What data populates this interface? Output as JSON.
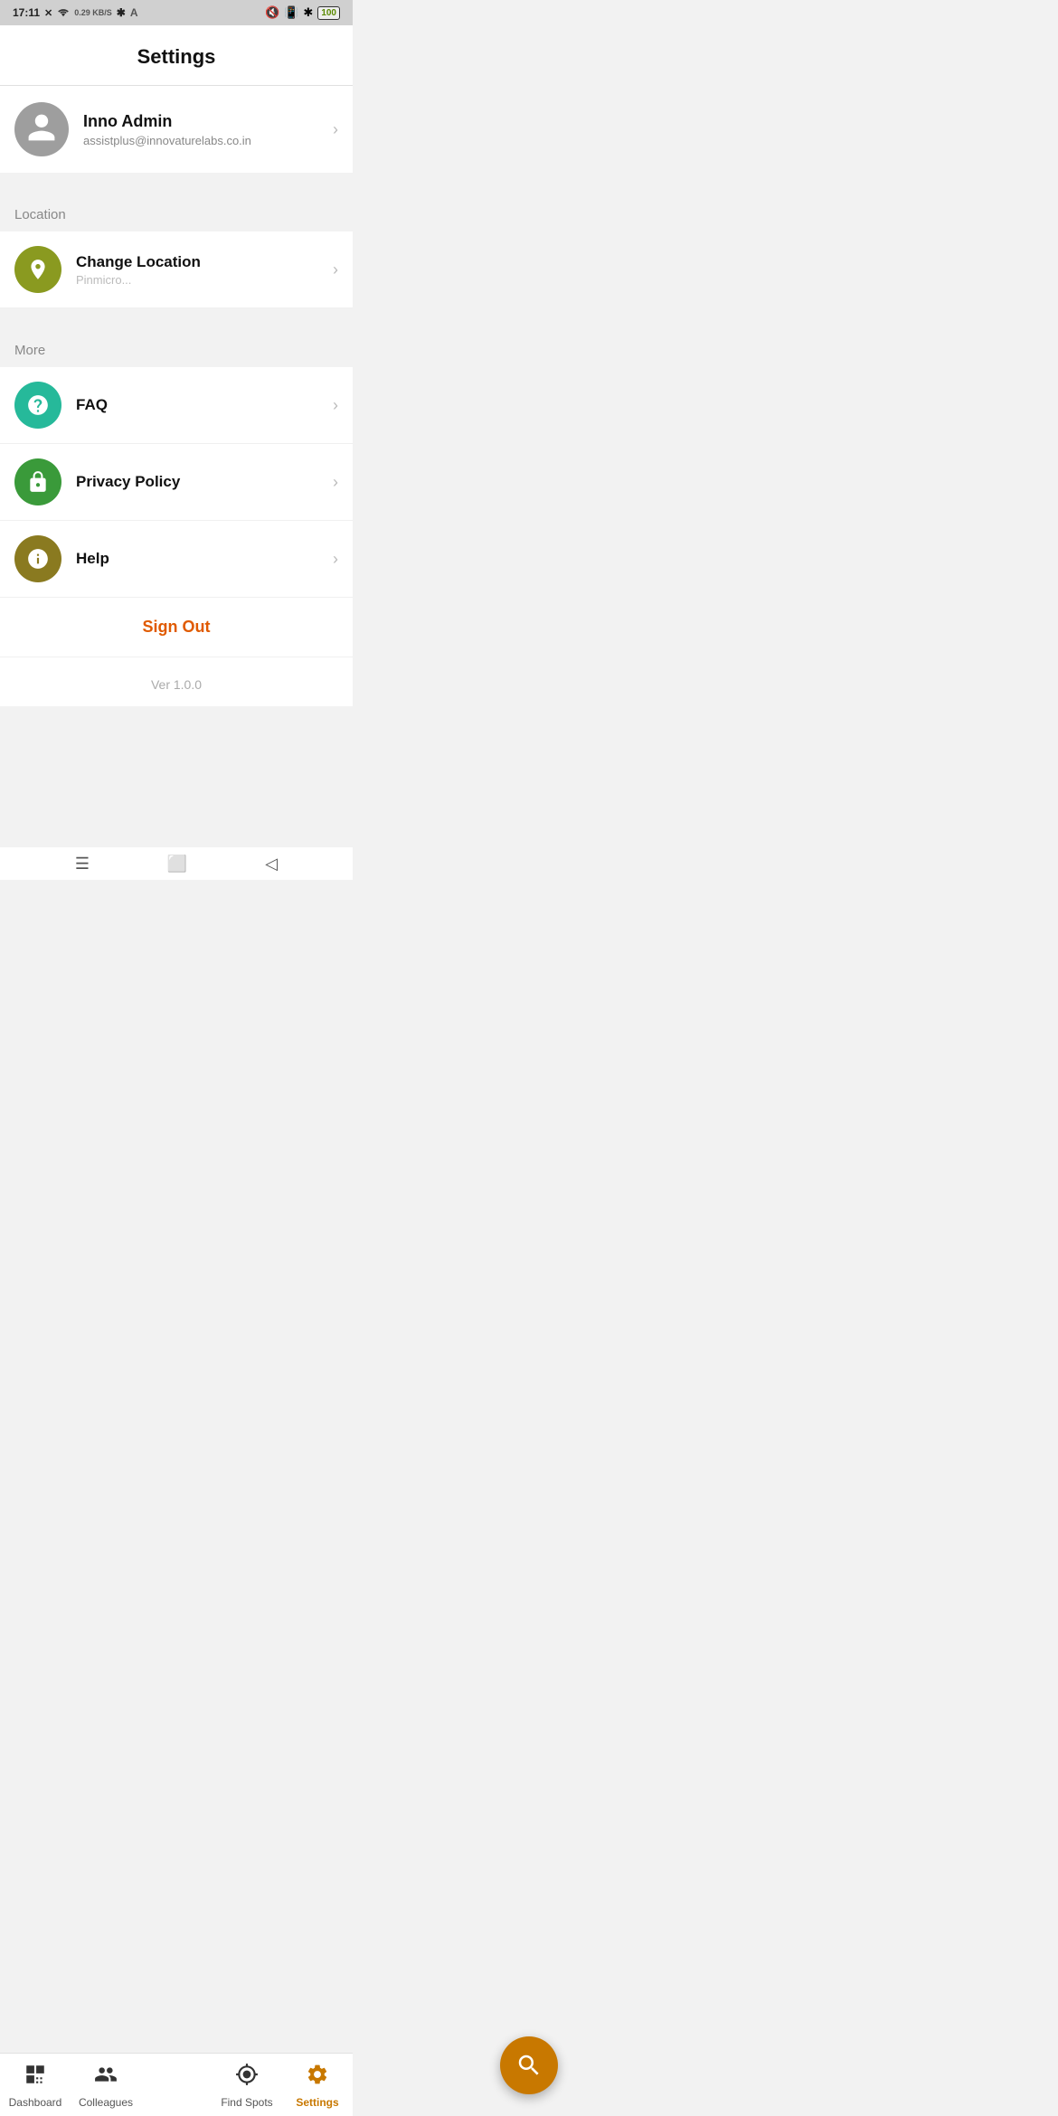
{
  "statusBar": {
    "time": "17:11",
    "network": "0.29 KB/S",
    "battery": "100"
  },
  "header": {
    "title": "Settings"
  },
  "profile": {
    "name": "Inno Admin",
    "email": "assistplus@innovaturelabs.co.in"
  },
  "sections": {
    "location": {
      "label": "Location",
      "items": [
        {
          "label": "Change Location",
          "sub": "Pinmicro...",
          "icon": "location",
          "iconColor": "olive"
        }
      ]
    },
    "more": {
      "label": "More",
      "items": [
        {
          "label": "FAQ",
          "icon": "question",
          "iconColor": "teal"
        },
        {
          "label": "Privacy Policy",
          "icon": "lock",
          "iconColor": "green"
        },
        {
          "label": "Help",
          "icon": "info",
          "iconColor": "darkolive"
        }
      ]
    }
  },
  "signOut": {
    "label": "Sign Out"
  },
  "version": {
    "label": "Ver",
    "number": "1.0.0"
  },
  "bottomNav": {
    "items": [
      {
        "label": "Dashboard",
        "icon": "dashboard",
        "active": false
      },
      {
        "label": "Colleagues",
        "icon": "colleagues",
        "active": false
      },
      {
        "label": "Find Spots",
        "icon": "findspots",
        "active": false
      },
      {
        "label": "Settings",
        "icon": "settings",
        "active": true
      }
    ]
  },
  "fab": {
    "icon": "search"
  }
}
